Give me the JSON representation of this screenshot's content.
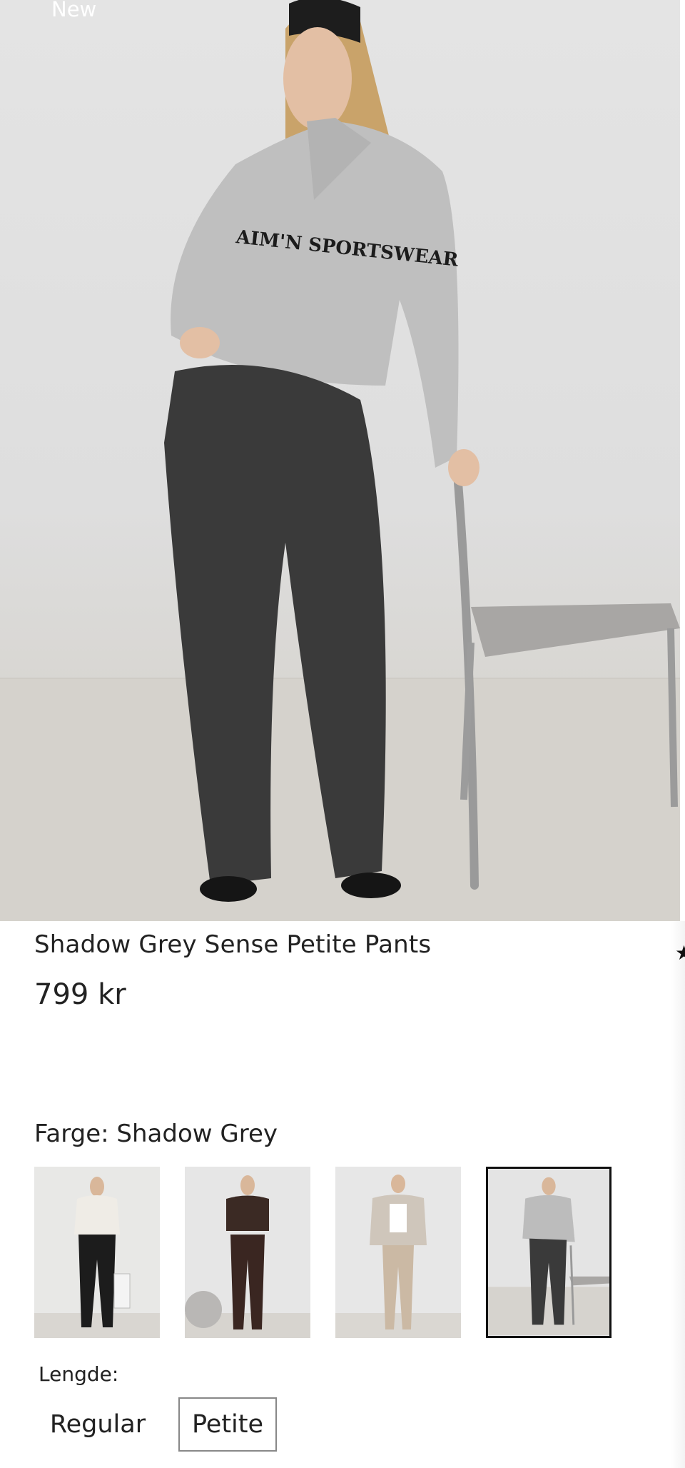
{
  "hero": {
    "badge": "New",
    "sweater_print": "AIM'N SPORTSWEAR"
  },
  "product": {
    "title": "Shadow Grey Sense Petite Pants",
    "price": "799 kr"
  },
  "color": {
    "label": "Farge: Shadow Grey",
    "options": [
      {
        "name": "black-pants-cream-sweater",
        "selected": false
      },
      {
        "name": "brown-pants",
        "selected": false
      },
      {
        "name": "beige-pants",
        "selected": false
      },
      {
        "name": "shadow-grey-pants",
        "selected": true
      }
    ]
  },
  "length": {
    "label": "Lengde:",
    "options": [
      {
        "label": "Regular",
        "selected": false
      },
      {
        "label": "Petite",
        "selected": true
      }
    ]
  },
  "colors": {
    "background": "#ffffff",
    "text": "#222222",
    "selected_border": "#111111",
    "pants_shadow_grey": "#3a3a3a"
  },
  "icons": {
    "wishlist": "star-icon"
  }
}
